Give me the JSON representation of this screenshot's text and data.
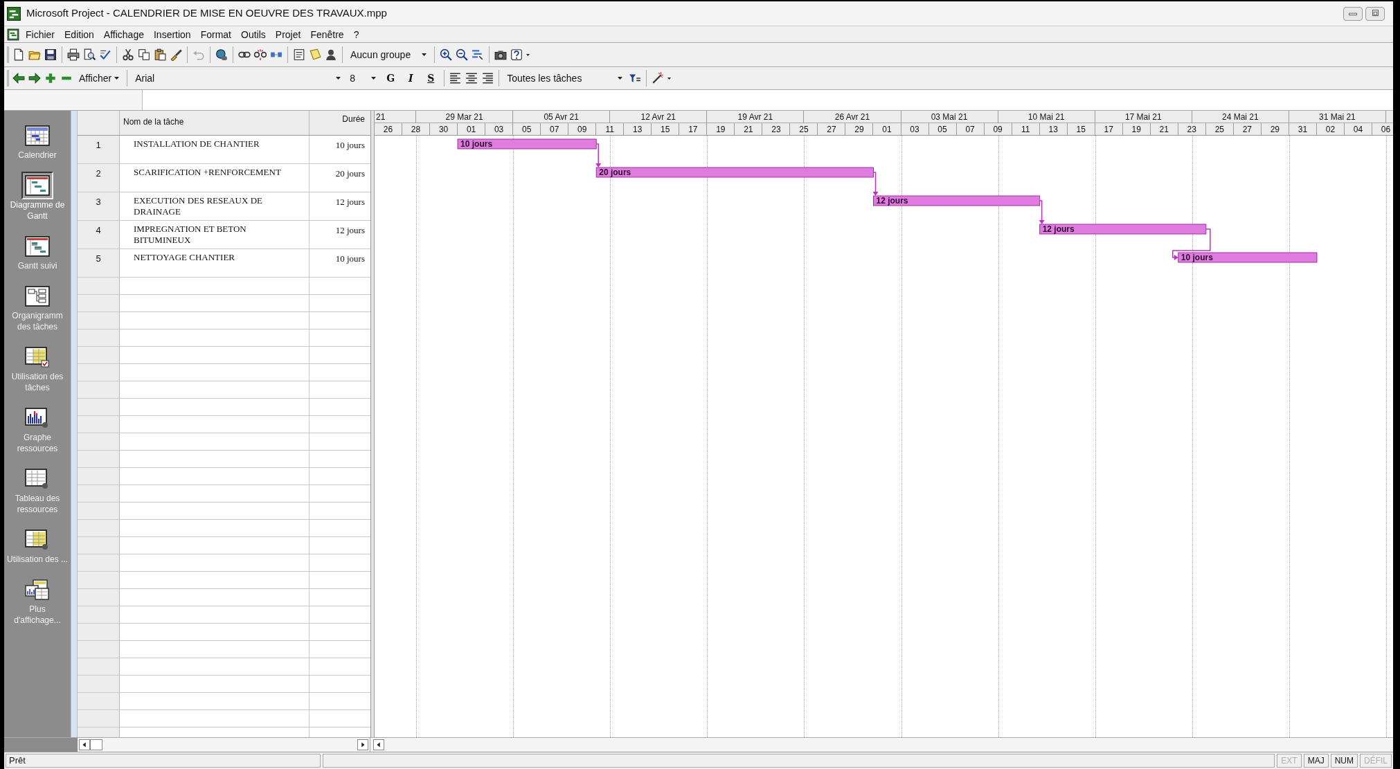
{
  "window": {
    "title": "Microsoft Project - CALENDRIER DE MISE EN OEUVRE DES TRAVAUX.mpp"
  },
  "menu": [
    "Fichier",
    "Edition",
    "Affichage",
    "Insertion",
    "Format",
    "Outils",
    "Projet",
    "Fenêtre",
    "?"
  ],
  "standard_toolbar": {
    "group_dropdown": "Aucun groupe"
  },
  "formatting_toolbar": {
    "show_menu": "Afficher",
    "font": "Arial",
    "font_size": "8",
    "bold": "G",
    "italic": "I",
    "underline": "S",
    "filter": "Toutes les tâches"
  },
  "view_bar": [
    {
      "label": "Calendrier",
      "selected": false
    },
    {
      "label": "Diagramme de Gantt",
      "selected": true
    },
    {
      "label": "Gantt suivi",
      "selected": false
    },
    {
      "label": "Organigramm des tâches",
      "selected": false
    },
    {
      "label": "Utilisation des tâches",
      "selected": false
    },
    {
      "label": "Graphe ressources",
      "selected": false
    },
    {
      "label": "Tableau des ressources",
      "selected": false
    },
    {
      "label": "Utilisation des ...",
      "selected": false
    },
    {
      "label": "Plus d'affichage...",
      "selected": false
    }
  ],
  "table": {
    "columns": [
      "Nom de la tâche",
      "Durée"
    ],
    "rows": [
      {
        "id": "1",
        "name": "INSTALLATION DE CHANTIER",
        "duration": "10 jours",
        "linked_to_next": true
      },
      {
        "id": "2",
        "name": "SCARIFICATION +RENFORCEMENT",
        "duration": "20 jours",
        "linked_to_next": true
      },
      {
        "id": "3",
        "name": "EXECUTION DES RESEAUX DE DRAINAGE",
        "duration": "12 jours",
        "linked_to_next": true
      },
      {
        "id": "4",
        "name": "IMPREGNATION ET BETON BITUMINEUX",
        "duration": "12 jours",
        "linked_to_next": true
      },
      {
        "id": "5",
        "name": "NETTOYAGE CHANTIER",
        "duration": "10 jours",
        "linked_to_next": false
      }
    ]
  },
  "gantt": {
    "timescale_minor": [
      "26",
      "28",
      "30",
      "01",
      "03",
      "05",
      "07",
      "09",
      "11",
      "13",
      "15",
      "17",
      "19",
      "21",
      "23",
      "25",
      "27",
      "29",
      "01",
      "03",
      "05",
      "07",
      "09",
      "11",
      "13",
      "15",
      "17",
      "19",
      "21",
      "23",
      "25",
      "27",
      "29",
      "31",
      "02",
      "04",
      "06"
    ],
    "timescale_major": [
      "21",
      "29 Mar 21",
      "05 Avr 21",
      "12 Avr 21",
      "19 Avr 21",
      "26 Avr 21",
      "03 Mai 21",
      "10 Mai 21",
      "17 Mai 21",
      "24 Mai 21",
      "31 Mai 21"
    ],
    "bar_labels": [
      "10 jours",
      "20 jours",
      "12 jours",
      "12 jours",
      "10 jours"
    ]
  },
  "status_bar": {
    "message": "Prêt",
    "indicators": [
      {
        "label": "EXT",
        "on": false
      },
      {
        "label": "MAJ",
        "on": true
      },
      {
        "label": "NUM",
        "on": true
      },
      {
        "label": "DÉFIL",
        "on": false
      }
    ]
  }
}
